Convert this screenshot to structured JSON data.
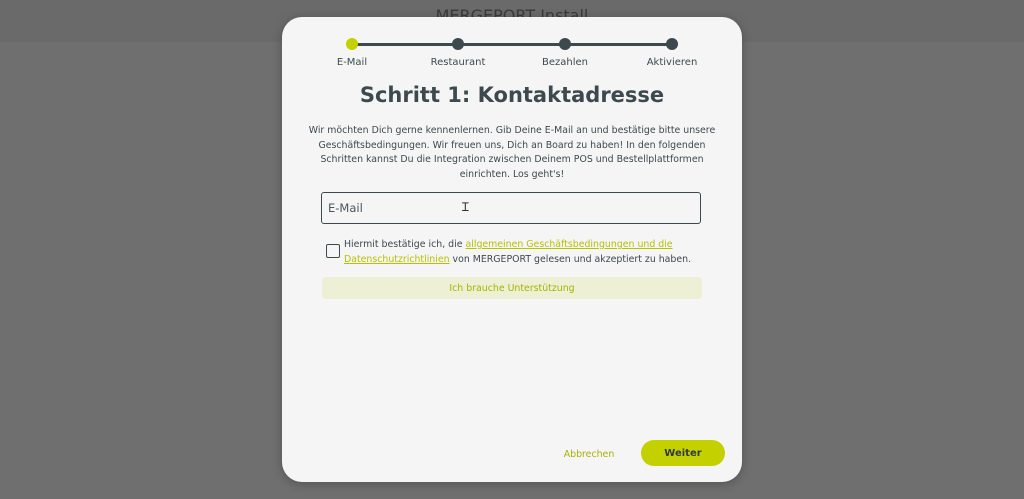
{
  "background": {
    "title": "MERGEPORT Install"
  },
  "stepper": {
    "steps": [
      {
        "label": "E-Mail",
        "active": true
      },
      {
        "label": "Restaurant",
        "active": false
      },
      {
        "label": "Bezahlen",
        "active": false
      },
      {
        "label": "Aktivieren",
        "active": false
      }
    ]
  },
  "form": {
    "title": "Schritt 1: Kontaktadresse",
    "intro": "Wir möchten Dich gerne kennenlernen. Gib Deine E-Mail an und bestätige bitte unsere Geschäftsbedingungen. Wir freuen uns, Dich an Board zu haben! In den folgenden Schritten kannst Du die Integration zwischen Deinem POS und Bestellplattformen einrichten. Los geht's!",
    "email_placeholder": "E-Mail",
    "email_value": "",
    "consent_prefix": "Hiermit bestätige ich, die ",
    "consent_link": "allgemeinen Geschäftsbedingungen und die Datenschutzrichtlinien",
    "consent_suffix": " von MERGEPORT gelesen und akzeptiert zu haben.",
    "help_label": "Ich brauche Unterstützung",
    "cancel_label": "Abbrechen",
    "next_label": "Weiter"
  },
  "colors": {
    "accent": "#c4d000",
    "text": "#3c4a4f",
    "overlay": "#6f6f6f"
  }
}
